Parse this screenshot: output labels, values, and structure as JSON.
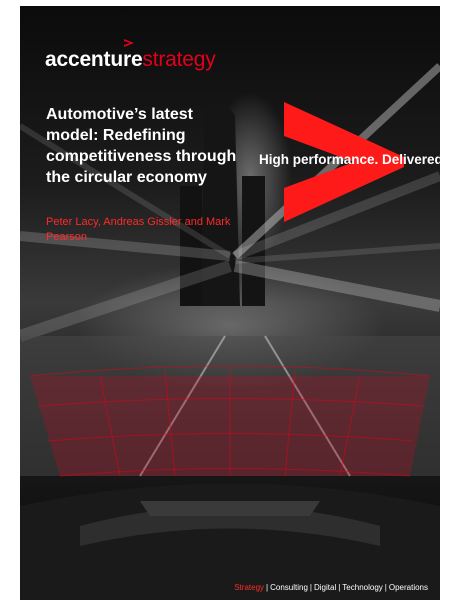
{
  "logo": {
    "brand": "accenture",
    "division": "strategy"
  },
  "title": "Automotive’s latest model: Redefining competitiveness through the circular economy",
  "authors": "Peter Lacy, Andreas Gissler and Mark Pearson",
  "tagline": "High performance. Delivered.",
  "footer": {
    "items": [
      "Strategy",
      "Consulting",
      "Digital",
      "Technology",
      "Operations"
    ],
    "separator": "|"
  },
  "colors": {
    "brand_red": "#e2001a",
    "author_red": "#ff2a2a",
    "text_white": "#ffffff"
  },
  "icons": {
    "logo_mark": "accenture-caret-icon",
    "chevron": "accenture-greater-than-chevron"
  }
}
